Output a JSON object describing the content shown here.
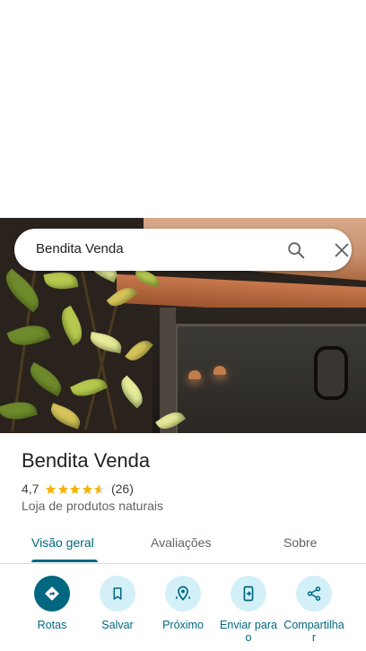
{
  "search": {
    "query": "Bendita Venda"
  },
  "place": {
    "name": "Bendita Venda",
    "rating": "4,7",
    "stars_value": 4.7,
    "reviews": "(26)",
    "category": "Loja de produtos naturais"
  },
  "tabs": [
    {
      "label": "Visão geral",
      "active": true
    },
    {
      "label": "Avaliações",
      "active": false
    },
    {
      "label": "Sobre",
      "active": false
    }
  ],
  "actions": [
    {
      "label": "Rotas",
      "icon": "directions-icon",
      "primary": true
    },
    {
      "label": "Salvar",
      "icon": "bookmark-icon",
      "primary": false
    },
    {
      "label": "Próximo",
      "icon": "nearby-icon",
      "primary": false
    },
    {
      "label": "Enviar para o",
      "icon": "send-to-phone-icon",
      "primary": false
    },
    {
      "label": "Compartilhar",
      "icon": "share-icon",
      "primary": false
    }
  ],
  "colors": {
    "accent": "#00677f",
    "action_bg": "#d3f0f8",
    "star": "#f4b400"
  }
}
